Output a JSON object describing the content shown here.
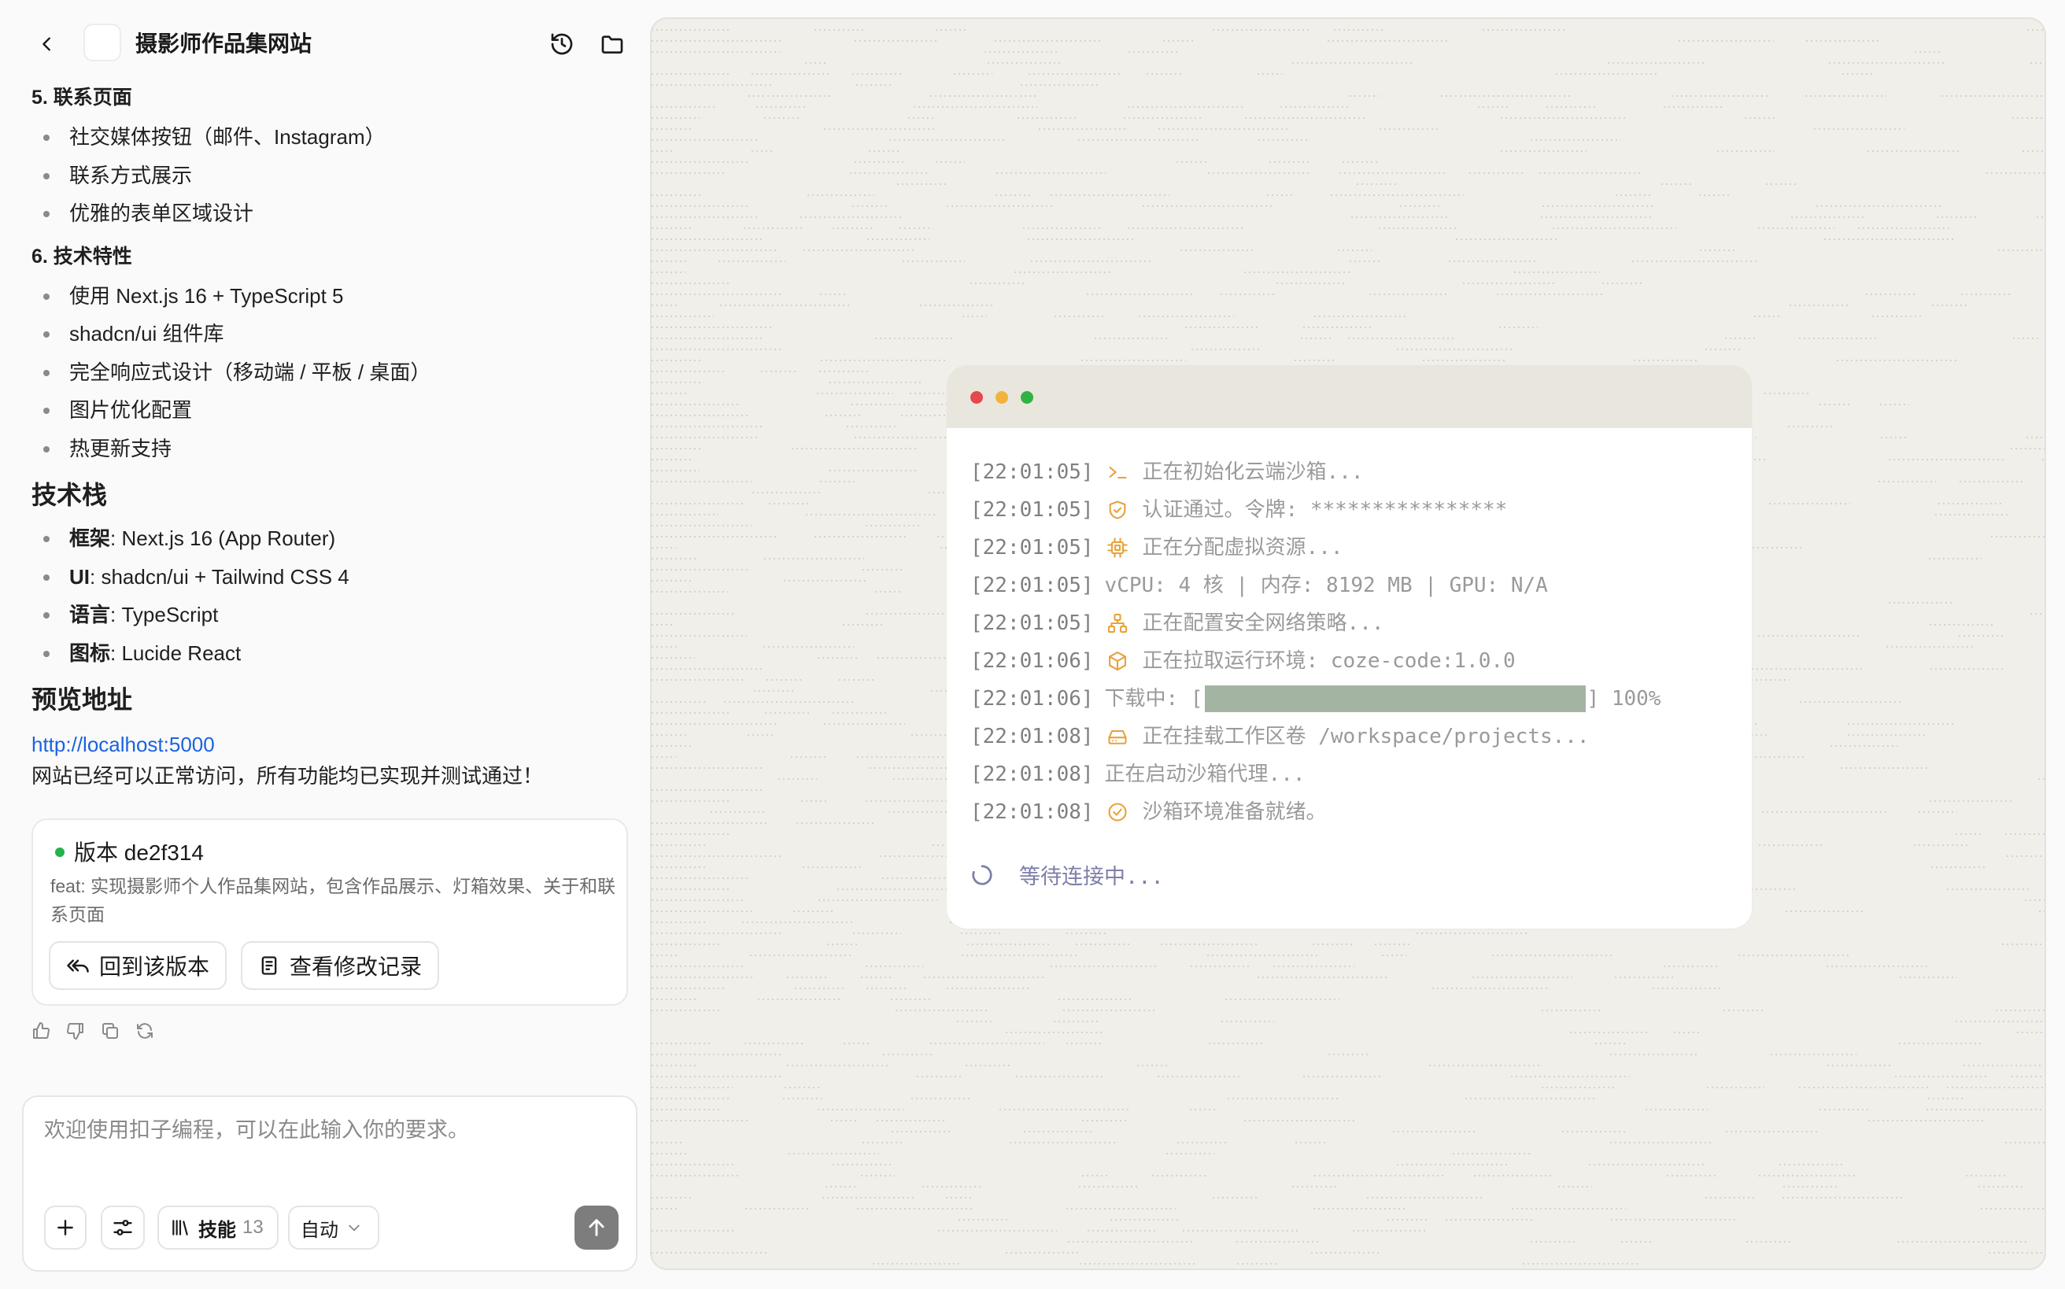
{
  "header": {
    "title": "摄影师作品集网站"
  },
  "sections": [
    {
      "heading": "5. 联系页面",
      "items": [
        "社交媒体按钮（邮件、Instagram）",
        "联系方式展示",
        "优雅的表单区域设计"
      ]
    },
    {
      "heading": "6. 技术特性",
      "items": [
        "使用 Next.js 16 + TypeScript 5",
        "shadcn/ui 组件库",
        "完全响应式设计（移动端 / 平板 / 桌面）",
        "图片优化配置",
        "热更新支持"
      ]
    }
  ],
  "tech_stack": {
    "heading": "技术栈",
    "items": [
      {
        "key": "框架",
        "value": ": Next.js 16 (App Router)"
      },
      {
        "key": "UI",
        "value": ": shadcn/ui + Tailwind CSS 4"
      },
      {
        "key": "语言",
        "value": ": TypeScript"
      },
      {
        "key": "图标",
        "value": ": Lucide React"
      }
    ]
  },
  "preview": {
    "heading": "预览地址",
    "url": "http://localhost:5000",
    "note": "网站已经可以正常访问，所有功能均已实现并测试通过！"
  },
  "version_card": {
    "title": "版本 de2f314",
    "status_color": "#22b34b",
    "description": "feat: 实现摄影师个人作品集网站，包含作品展示、灯箱效果、关于和联系页面",
    "restore_label": "回到该版本",
    "changes_label": "查看修改记录"
  },
  "composer": {
    "placeholder": "欢迎使用扣子编程，可以在此输入你的要求。",
    "skills_label": "技能",
    "skills_count": "13",
    "mode_label": "自动"
  },
  "terminal": {
    "dot_colors": [
      "#e5484d",
      "#f2b33d",
      "#2fb344"
    ],
    "lines": [
      {
        "time": "[22:01:05]",
        "icon": "terminal-icon",
        "text": "正在初始化云端沙箱..."
      },
      {
        "time": "[22:01:05]",
        "icon": "shield-check-icon",
        "text": "认证通过。令牌: ****************"
      },
      {
        "time": "[22:01:05]",
        "icon": "cpu-icon",
        "text": "正在分配虚拟资源..."
      },
      {
        "time": "[22:01:05]",
        "icon": "",
        "text": "vCPU: 4 核 | 内存: 8192 MB | GPU: N/A"
      },
      {
        "time": "[22:01:05]",
        "icon": "network-icon",
        "text": "正在配置安全网络策略..."
      },
      {
        "time": "[22:01:06]",
        "icon": "package-icon",
        "text": "正在拉取运行环境: coze-code:1.0.0"
      },
      {
        "time": "[22:01:06]",
        "icon": "",
        "text_before": "下载中: [",
        "progress": 1.0,
        "text_after": "] 100%"
      },
      {
        "time": "[22:01:08]",
        "icon": "hard-drive-icon",
        "text": "正在挂载工作区卷 /workspace/projects..."
      },
      {
        "time": "[22:01:08]",
        "icon": "",
        "text": "正在启动沙箱代理..."
      },
      {
        "time": "[22:01:08]",
        "icon": "check-circle-icon",
        "text": "沙箱环境准备就绪。"
      }
    ],
    "waiting": "等待连接中...",
    "accent_color": "#e8a23a"
  }
}
